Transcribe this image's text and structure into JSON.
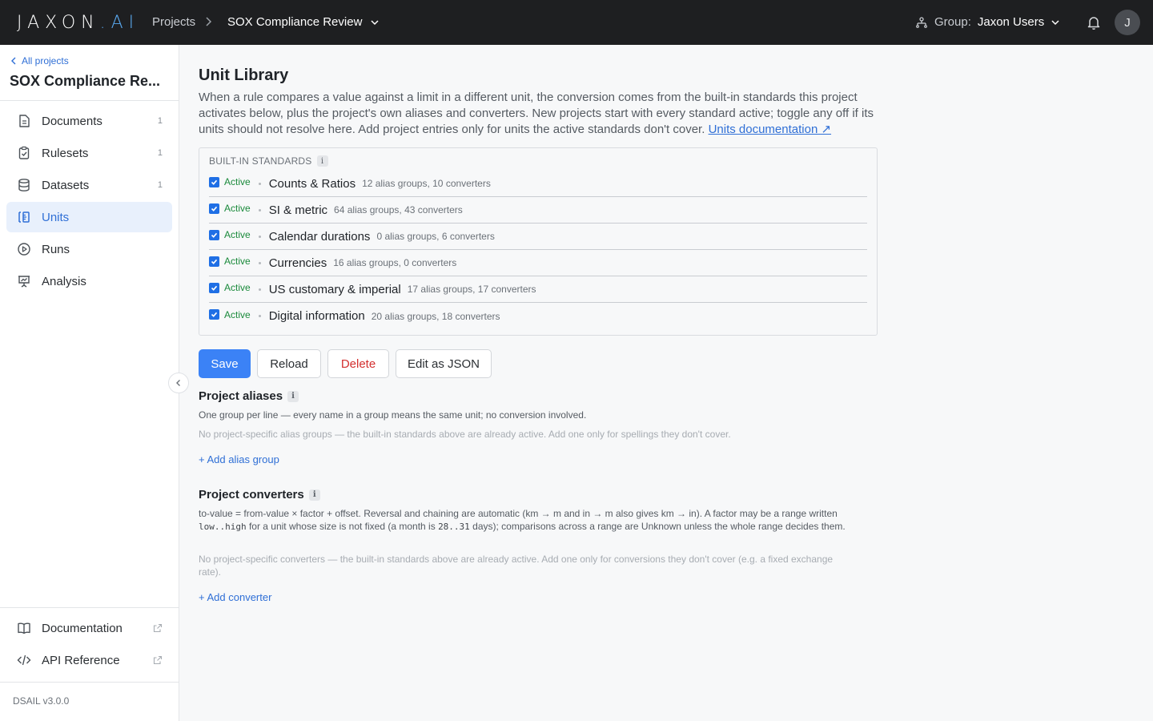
{
  "topbar": {
    "logo_main": "JAXON",
    "logo_suffix": ".AI",
    "crumb_projects": "Projects",
    "crumb_current": "SOX Compliance Review",
    "group_label": "Group:",
    "group_name": "Jaxon Users",
    "avatar_initial": "J"
  },
  "sidebar": {
    "back_label": "All projects",
    "project_title": "SOX Compliance Re...",
    "nav": [
      {
        "label": "Documents",
        "count": "1",
        "icon": "document-icon"
      },
      {
        "label": "Rulesets",
        "count": "1",
        "icon": "clipboard-icon"
      },
      {
        "label": "Datasets",
        "count": "1",
        "icon": "database-icon"
      },
      {
        "label": "Units",
        "count": "",
        "icon": "units-icon",
        "active": true
      },
      {
        "label": "Runs",
        "count": "",
        "icon": "play-circle-icon"
      },
      {
        "label": "Analysis",
        "count": "",
        "icon": "presentation-chart-icon"
      }
    ],
    "footer": [
      {
        "label": "Documentation",
        "icon": "book-icon"
      },
      {
        "label": "API Reference",
        "icon": "code-icon"
      }
    ],
    "version": "DSAIL v3.0.0"
  },
  "main": {
    "title": "Unit Library",
    "intro": "When a rule compares a value against a limit in a different unit, the conversion comes from the built-in standards this project activates below, plus the project's own aliases and converters. New projects start with every standard active; toggle any off if its units should not resolve here. Add project entries only for units the active standards don't cover. ",
    "intro_link": "Units documentation ↗",
    "standards_heading": "BUILT-IN STANDARDS",
    "info_glyph": "i",
    "standards": [
      {
        "status": "Active",
        "name": "Counts & Ratios",
        "meta": "12 alias groups, 10 converters"
      },
      {
        "status": "Active",
        "name": "SI & metric",
        "meta": "64 alias groups, 43 converters"
      },
      {
        "status": "Active",
        "name": "Calendar durations",
        "meta": "0 alias groups, 6 converters"
      },
      {
        "status": "Active",
        "name": "Currencies",
        "meta": "16 alias groups, 0 converters"
      },
      {
        "status": "Active",
        "name": "US customary & imperial",
        "meta": "17 alias groups, 17 converters"
      },
      {
        "status": "Active",
        "name": "Digital information",
        "meta": "20 alias groups, 18 converters"
      }
    ],
    "buttons": {
      "save": "Save",
      "reload": "Reload",
      "delete": "Delete",
      "edit_json": "Edit as JSON"
    },
    "aliases": {
      "title": "Project aliases",
      "desc": "One group per line — every name in a group means the same unit; no conversion involved.",
      "empty": "No project-specific alias groups — the built-in standards above are already active. Add one only for spellings they don't cover.",
      "add": "+ Add alias group"
    },
    "converters": {
      "title": "Project converters",
      "desc_a": "to-value = from-value × factor + offset. Reversal and chaining are automatic (km → m and in → m also gives km → in). A factor may be a range written ",
      "desc_code1": "low..high",
      "desc_b": " for a unit whose size is not fixed (a month is ",
      "desc_code2": "28..31",
      "desc_c": " days); comparisons across a range are Unknown unless the whole range decides them.",
      "empty": "No project-specific converters — the built-in standards above are already active. Add one only for conversions they don't cover (e.g. a fixed exchange rate).",
      "add": "+ Add converter"
    }
  }
}
